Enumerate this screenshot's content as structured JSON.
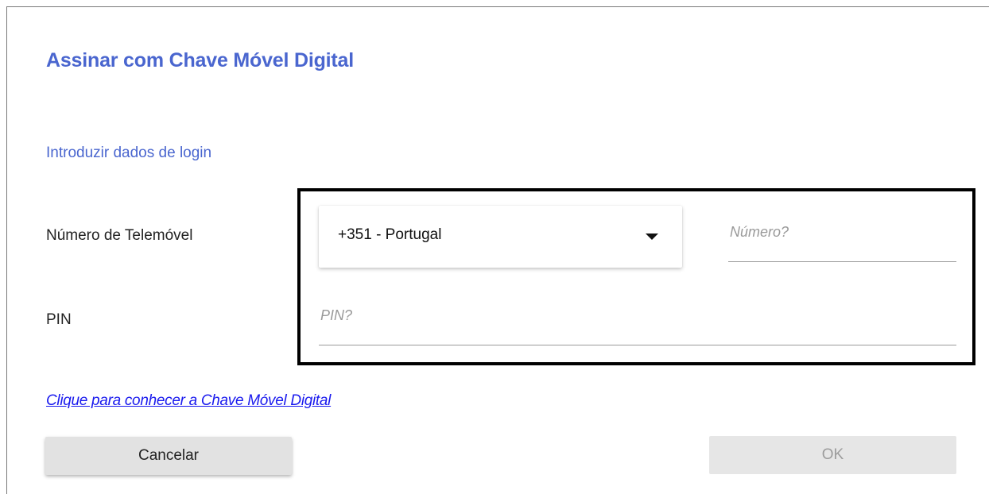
{
  "dialog": {
    "title": "Assinar com Chave Móvel Digital",
    "subtitle": "Introduzir dados de login"
  },
  "form": {
    "phone_label": "Número de Telemóvel",
    "country_select": {
      "selected": "+351 - Portugal"
    },
    "number_input": {
      "placeholder": "Número?",
      "value": ""
    },
    "pin_label": "PIN",
    "pin_input": {
      "placeholder": "PIN?",
      "value": ""
    }
  },
  "link": {
    "text": "Clique para conhecer a Chave Móvel Digital"
  },
  "buttons": {
    "cancel_label": "Cancelar",
    "ok_label": "OK"
  },
  "colors": {
    "accent": "#4a66cf",
    "link": "#1a1aee",
    "highlight_border": "#000000"
  },
  "icons": {
    "country_dropdown": "caret-down-icon"
  }
}
